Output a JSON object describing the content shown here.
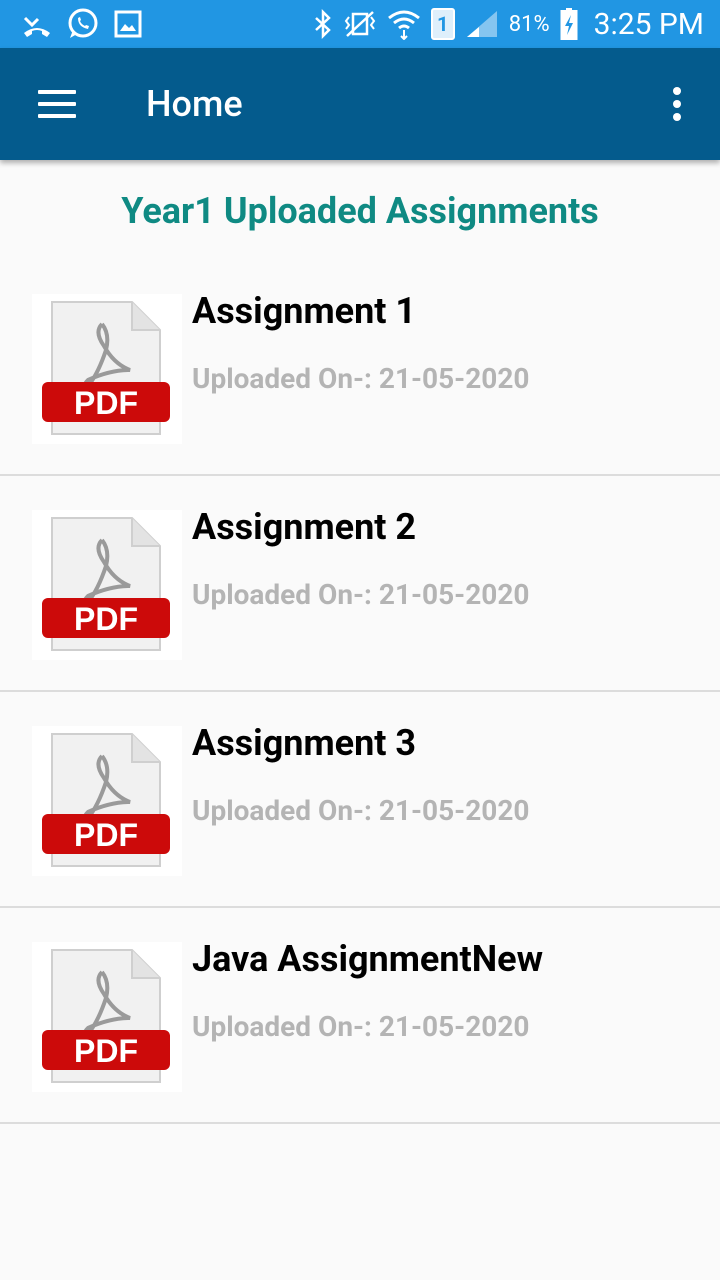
{
  "status_bar": {
    "battery_percent": "81%",
    "sim_slot": "1",
    "time": "3:25 PM",
    "icons": [
      "missed-call-icon",
      "whatsapp-icon",
      "gallery-icon",
      "bluetooth-icon",
      "vibrate-icon",
      "wifi-icon",
      "sim-icon",
      "signal-icon",
      "battery-charging-icon"
    ]
  },
  "app_bar": {
    "title": "Home",
    "menu_icon": "hamburger-menu-icon",
    "overflow_icon": "more-vert-icon",
    "background": "#045b8d"
  },
  "section": {
    "title": "Year1 Uploaded Assignments",
    "title_color": "#0f8a83"
  },
  "assignments": [
    {
      "title": "Assignment 1",
      "uploaded": "Uploaded On-: 21-05-2020",
      "icon": "pdf-file-icon",
      "badge": "PDF"
    },
    {
      "title": "Assignment 2",
      "uploaded": "Uploaded On-: 21-05-2020",
      "icon": "pdf-file-icon",
      "badge": "PDF"
    },
    {
      "title": "Assignment 3",
      "uploaded": "Uploaded On-: 21-05-2020",
      "icon": "pdf-file-icon",
      "badge": "PDF"
    },
    {
      "title": "Java AssignmentNew",
      "uploaded": "Uploaded On-: 21-05-2020",
      "icon": "pdf-file-icon",
      "badge": "PDF"
    }
  ]
}
